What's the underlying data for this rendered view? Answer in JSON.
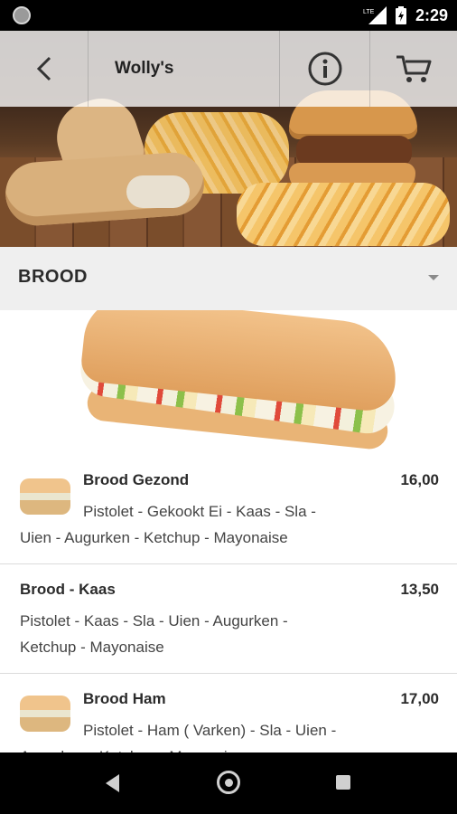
{
  "status_bar": {
    "time": "2:29",
    "network": "LTE"
  },
  "toolbar": {
    "title": "Wolly's"
  },
  "section": {
    "title": "BROOD"
  },
  "items": [
    {
      "name": "Brood Gezond",
      "price": "16,00",
      "desc_line1": "Pistolet - Gekookt Ei - Kaas - Sla -",
      "desc_line2": "Uien - Augurken - Ketchup - Mayonaise",
      "has_thumb": true
    },
    {
      "name": "Brood - Kaas",
      "price": "13,50",
      "desc_line1": "Pistolet - Kaas - Sla - Uien - Augurken -",
      "desc_line2": "Ketchup - Mayonaise",
      "has_thumb": false
    },
    {
      "name": "Brood Ham",
      "price": "17,00",
      "desc_line1": "Pistolet - Ham ( Varken) - Sla - Uien -",
      "desc_line2": "Augurken - Ketchup - Mayonaise",
      "has_thumb": true
    }
  ]
}
